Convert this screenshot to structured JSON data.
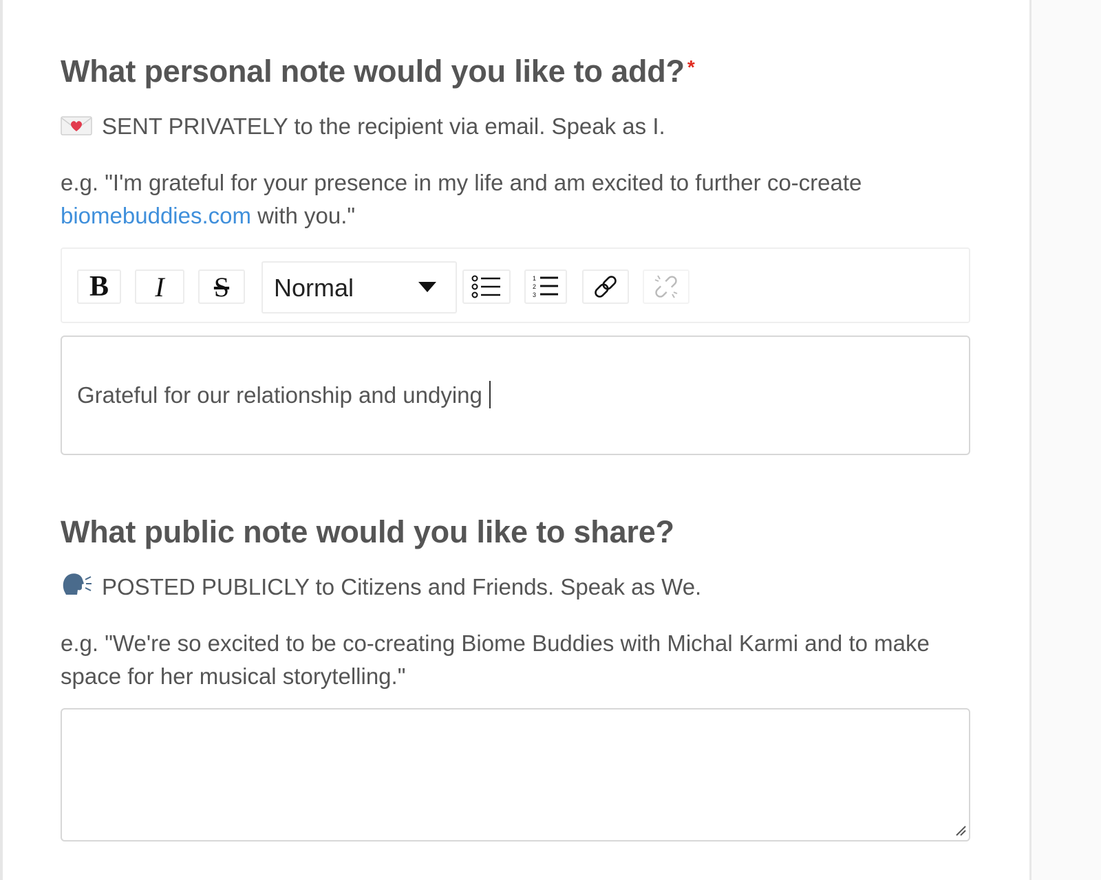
{
  "personal": {
    "title": "What personal note would you like to add?",
    "required_mark": "*",
    "emoji_icon": "love-letter-icon",
    "instruction": "SENT PRIVATELY to the recipient via email. Speak as I.",
    "example_prefix": "e.g. \"I'm grateful for your presence in my life and am excited to further co-create ",
    "example_link": "biomebuddies.com",
    "example_suffix": " with you.\""
  },
  "toolbar": {
    "bold_label": "B",
    "italic_label": "I",
    "strike_label": "S",
    "format_selected": "Normal",
    "bullet_list_icon": "bullet-list-icon",
    "ordered_list_icon": "ordered-list-icon",
    "link_icon": "link-icon",
    "unlink_icon": "unlink-icon"
  },
  "editor": {
    "value": "Grateful for our relationship and undying"
  },
  "public": {
    "title": "What public note would you like to share?",
    "emoji_icon": "speaking-head-icon",
    "instruction": "POSTED PUBLICLY to Citizens and Friends. Speak as We.",
    "example": "e.g. \"We're so excited to be co-creating Biome Buddies with Michal Karmi and to make space for her musical storytelling.\"",
    "textarea_value": ""
  },
  "colors": {
    "text": "#555555",
    "link": "#3f8fdb",
    "required": "#e02b20",
    "border": "#d7d7d7"
  }
}
